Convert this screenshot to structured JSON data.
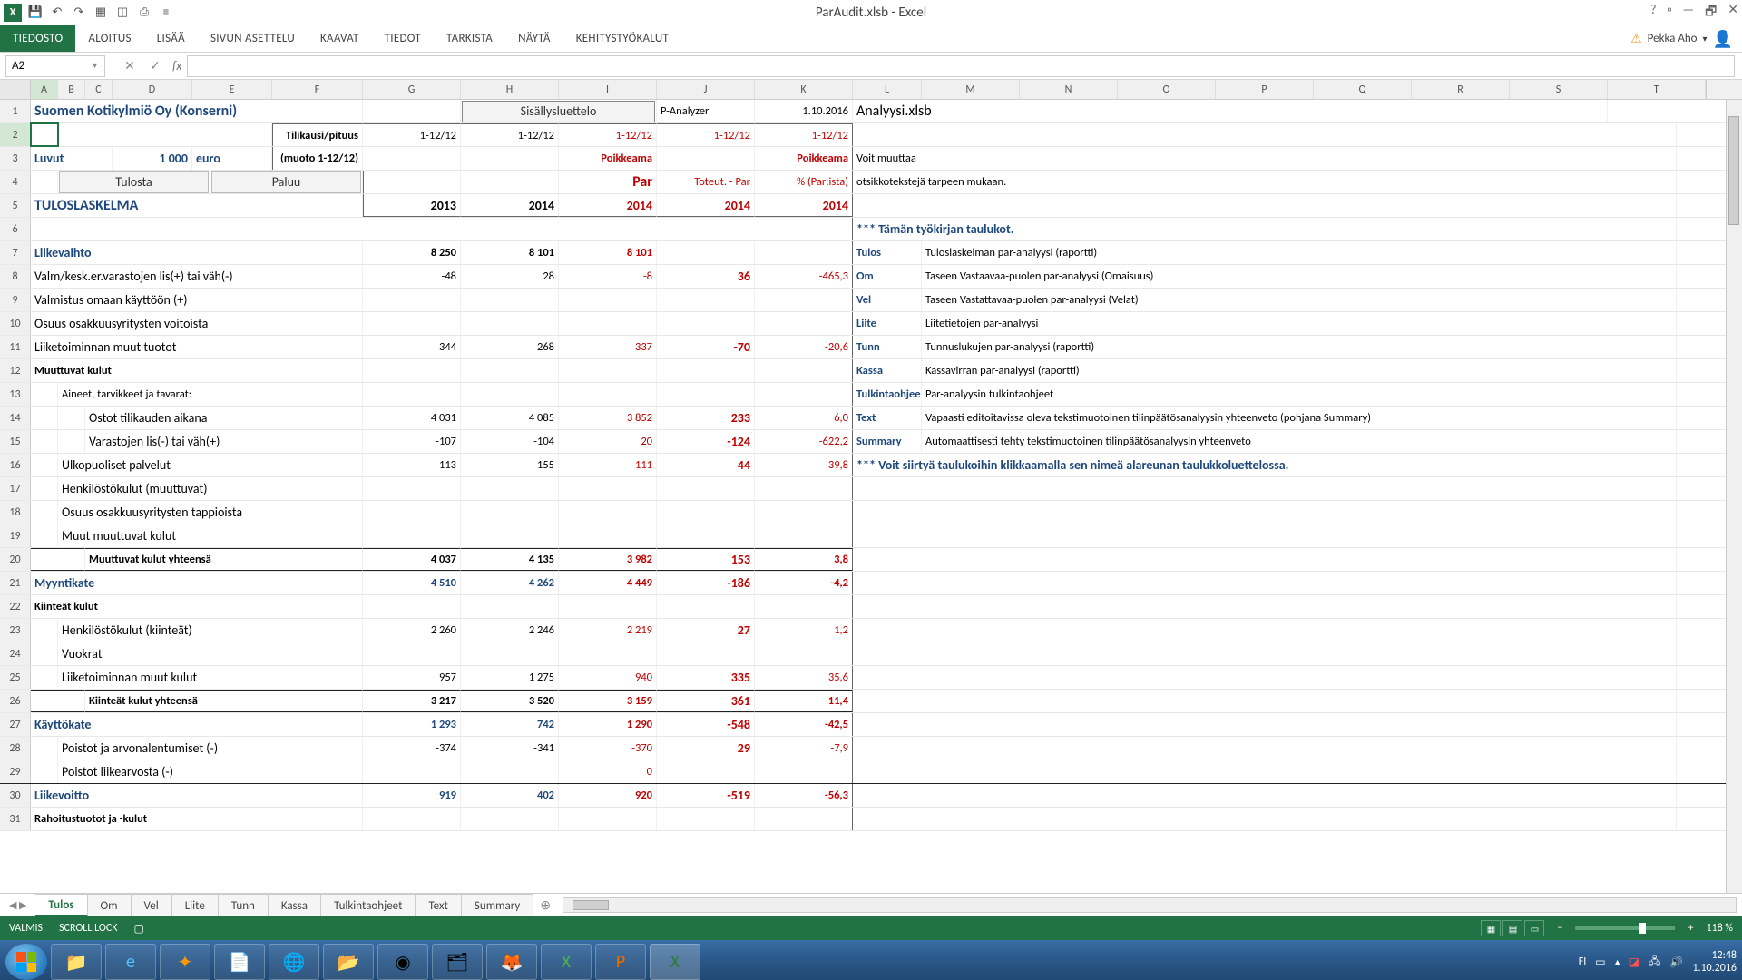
{
  "app": {
    "title": "ParAudit.xlsb - Excel",
    "user": "Pekka Aho"
  },
  "ribbon": {
    "tabs": [
      "TIEDOSTO",
      "ALOITUS",
      "LISÄÄ",
      "SIVUN ASETTELU",
      "KAAVAT",
      "TIEDOT",
      "TARKISTA",
      "NÄYTÄ",
      "KEHITYSTYÖKALUT"
    ]
  },
  "namebox": "A2",
  "columns": [
    "A",
    "B",
    "C",
    "D",
    "E",
    "F",
    "G",
    "H",
    "I",
    "J",
    "K",
    "L",
    "M",
    "N",
    "O",
    "P",
    "Q",
    "R",
    "S",
    "T"
  ],
  "rows_count": 31,
  "sheet": {
    "r1": {
      "company": "Suomen Kotikylmiö Oy (Konserni)",
      "btn": "Sisällysluettelo",
      "p": "P-Analyzer",
      "date": "1.10.2016",
      "file": "Analyysi.xlsb"
    },
    "r2": {
      "f": "Tilikausi/pituus",
      "g": "1-12/12",
      "h": "1-12/12",
      "i": "1-12/12",
      "j": "1-12/12",
      "k": "1-12/12"
    },
    "r3": {
      "a": "Luvut",
      "d": "1 000",
      "e": "euro",
      "f": "(muoto 1-12/12)",
      "i": "Poikkeama",
      "k": "Poikkeama",
      "l": "Voit muuttaa"
    },
    "r4": {
      "btn1": "Tulosta",
      "btn2": "Paluu",
      "i": "Par",
      "j": "Toteut. - Par",
      "k": "% (Par:ista)",
      "l": "otsikkotekstejä tarpeen mukaan."
    },
    "r5": {
      "a": "TULOSLASKELMA",
      "g": "2013",
      "h": "2014",
      "i": "2014",
      "j": "2014",
      "k": "2014"
    },
    "r6": {
      "l": "*** Tämän työkirjan taulukot."
    },
    "r7": {
      "a": "Liikevaihto",
      "g": "8 250",
      "h": "8 101",
      "i": "8 101",
      "l": "Tulos",
      "m": "Tuloslaskelman par-analyysi (raportti)"
    },
    "r8": {
      "a": "Valm/kesk.er.varastojen lis(+) tai väh(-)",
      "g": "-48",
      "h": "28",
      "i": "-8",
      "j": "36",
      "k": "-465,3",
      "l": "Om",
      "m": "Taseen Vastaavaa-puolen par-analyysi (Omaisuus)"
    },
    "r9": {
      "a": "Valmistus omaan käyttöön (+)",
      "l": "Vel",
      "m": "Taseen Vastattavaa-puolen par-analyysi (Velat)"
    },
    "r10": {
      "a": "Osuus osakkuusyritysten voitoista",
      "l": "Liite",
      "m": "Liitetietojen par-analyysi"
    },
    "r11": {
      "a": "Liiketoiminnan muut tuotot",
      "g": "344",
      "h": "268",
      "i": "337",
      "j": "-70",
      "k": "-20,6",
      "l": "Tunn",
      "m": "Tunnuslukujen par-analyysi (raportti)"
    },
    "r12": {
      "a": "Muuttuvat kulut",
      "l": "Kassa",
      "m": "Kassavirran par-analyysi (raportti)"
    },
    "r13": {
      "a": "Aineet, tarvikkeet ja tavarat:",
      "l": "Tulkintaohjee",
      "m": "Par-analyysin tulkintaohjeet"
    },
    "r14": {
      "a": "Ostot tilikauden aikana",
      "g": "4 031",
      "h": "4 085",
      "i": "3 852",
      "j": "233",
      "k": "6,0",
      "l": "Text",
      "m": "Vapaasti editoitavissa oleva tekstimuotoinen tilinpäätösanalyysin yhteenveto (pohjana Summary)"
    },
    "r15": {
      "a": "Varastojen lis(-) tai väh(+)",
      "g": "-107",
      "h": "-104",
      "i": "20",
      "j": "-124",
      "k": "-622,2",
      "l": "Summary",
      "m": "Automaattisesti tehty tekstimuotoinen tilinpäätösanalyysin yhteenveto"
    },
    "r16": {
      "a": "Ulkopuoliset palvelut",
      "g": "113",
      "h": "155",
      "i": "111",
      "j": "44",
      "k": "39,8",
      "l": "*** Voit siirtyä taulukoihin klikkaamalla sen nimeä alareunan taulukkoluettelossa."
    },
    "r17": {
      "a": "Henkilöstökulut (muuttuvat)"
    },
    "r18": {
      "a": "Osuus osakkuusyritysten tappioista"
    },
    "r19": {
      "a": "Muut muuttuvat kulut"
    },
    "r20": {
      "a": "Muuttuvat kulut yhteensä",
      "g": "4 037",
      "h": "4 135",
      "i": "3 982",
      "j": "153",
      "k": "3,8"
    },
    "r21": {
      "a": "Myyntikate",
      "g": "4 510",
      "h": "4 262",
      "i": "4 449",
      "j": "-186",
      "k": "-4,2"
    },
    "r22": {
      "a": "Kiinteät kulut"
    },
    "r23": {
      "a": "Henkilöstökulut (kiinteät)",
      "g": "2 260",
      "h": "2 246",
      "i": "2 219",
      "j": "27",
      "k": "1,2"
    },
    "r24": {
      "a": "Vuokrat"
    },
    "r25": {
      "a": "Liiketoiminnan muut kulut",
      "g": "957",
      "h": "1 275",
      "i": "940",
      "j": "335",
      "k": "35,6"
    },
    "r26": {
      "a": "Kiinteät kulut yhteensä",
      "g": "3 217",
      "h": "3 520",
      "i": "3 159",
      "j": "361",
      "k": "11,4"
    },
    "r27": {
      "a": "Käyttökate",
      "g": "1 293",
      "h": "742",
      "i": "1 290",
      "j": "-548",
      "k": "-42,5"
    },
    "r28": {
      "a": "Poistot ja arvonalentumiset (-)",
      "g": "-374",
      "h": "-341",
      "i": "-370",
      "j": "29",
      "k": "-7,9"
    },
    "r29": {
      "a": "Poistot liikearvosta (-)",
      "i": "0"
    },
    "r30": {
      "a": "Liikevoitto",
      "g": "919",
      "h": "402",
      "i": "920",
      "j": "-519",
      "k": "-56,3"
    },
    "r31": {
      "a": "Rahoitustuotot ja -kulut"
    }
  },
  "sheet_tabs": [
    "Tulos",
    "Om",
    "Vel",
    "Liite",
    "Tunn",
    "Kassa",
    "Tulkintaohjeet",
    "Text",
    "Summary"
  ],
  "status": {
    "ready": "VALMIS",
    "scroll": "SCROLL LOCK",
    "zoom": "118 %"
  },
  "tray": {
    "lang": "FI",
    "time": "12:48",
    "date": "1.10.2016"
  }
}
